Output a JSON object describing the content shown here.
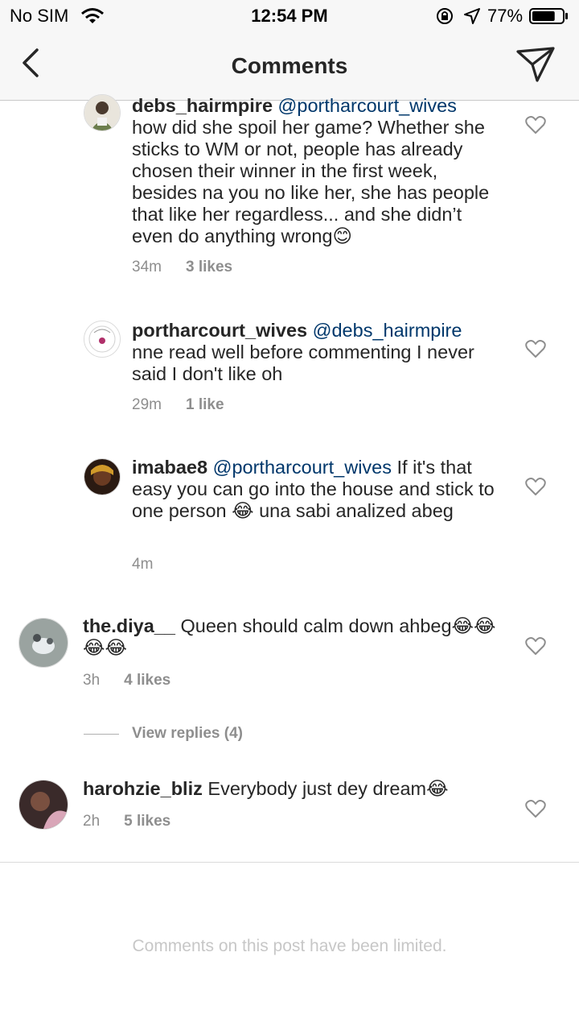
{
  "status_bar": {
    "carrier": "No SIM",
    "time": "12:54 PM",
    "battery_percent": "77%",
    "battery_level": 0.77,
    "icons": [
      "wifi-icon",
      "rotation-lock-icon",
      "location-icon",
      "battery-icon"
    ]
  },
  "nav": {
    "title": "Comments",
    "back_icon": "chevron-left-icon",
    "share_icon": "paper-plane-icon"
  },
  "comments": [
    {
      "username": "debs_hairmpire",
      "mention": "@portharcourt_wives",
      "text": "how did she spoil her game? Whether she sticks to WM or not, people has already chosen their winner in the first week, besides na you no like her, she has people that like her regardless... and she didn’t even do anything wrong😊",
      "time": "34m",
      "likes": "3 likes"
    },
    {
      "username": "portharcourt_wives",
      "mention": "@debs_hairmpire",
      "text": "nne read well before commenting I never said I don't like oh",
      "time": "29m",
      "likes": "1 like"
    },
    {
      "username": "imabae8",
      "mention": "@portharcourt_wives",
      "text": "If it's that easy you can go into the house and stick to one person 😂 una sabi analized abeg",
      "time": "4m",
      "likes": ""
    },
    {
      "username": "the.diya__",
      "mention": "",
      "text": "Queen should calm down ahbeg😂😂😂😂",
      "time": "3h",
      "likes": "4 likes"
    },
    {
      "username": "harohzie_bliz",
      "mention": "",
      "text": "Everybody just dey dream😂",
      "time": "2h",
      "likes": "5 likes"
    }
  ],
  "view_replies": "View replies (4)",
  "footer": {
    "limited_text": "Comments on this post have been limited."
  },
  "colors": {
    "mention": "#00376b",
    "meta": "#8e8e8e",
    "bar": "#f7f7f7"
  }
}
